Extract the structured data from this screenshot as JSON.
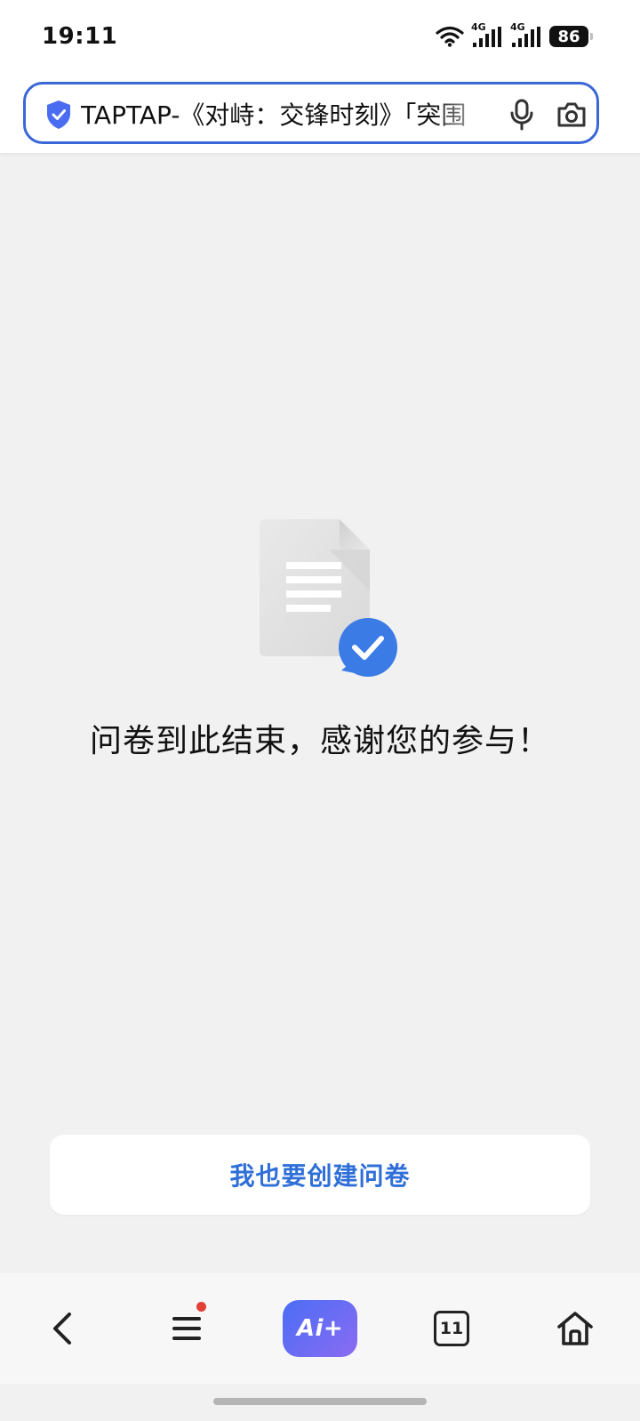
{
  "status_bar": {
    "time": "19:11",
    "network_1": "4G",
    "network_2": "4G",
    "battery": "86"
  },
  "address_bar": {
    "url_text": "TAPTAP-《对峙：交锋时刻》「突围"
  },
  "main": {
    "end_message": "问卷到此结束，感谢您的参与！",
    "create_button": "我也要创建问卷"
  },
  "bottom_nav": {
    "ai_label": "Ai+",
    "tab_count": "11"
  },
  "colors": {
    "accent": "#3a66d6",
    "link_blue": "#2f6fd8",
    "ai_gradient_start": "#4b6df5",
    "ai_gradient_end": "#8a6cf2",
    "notification": "#e04035"
  }
}
